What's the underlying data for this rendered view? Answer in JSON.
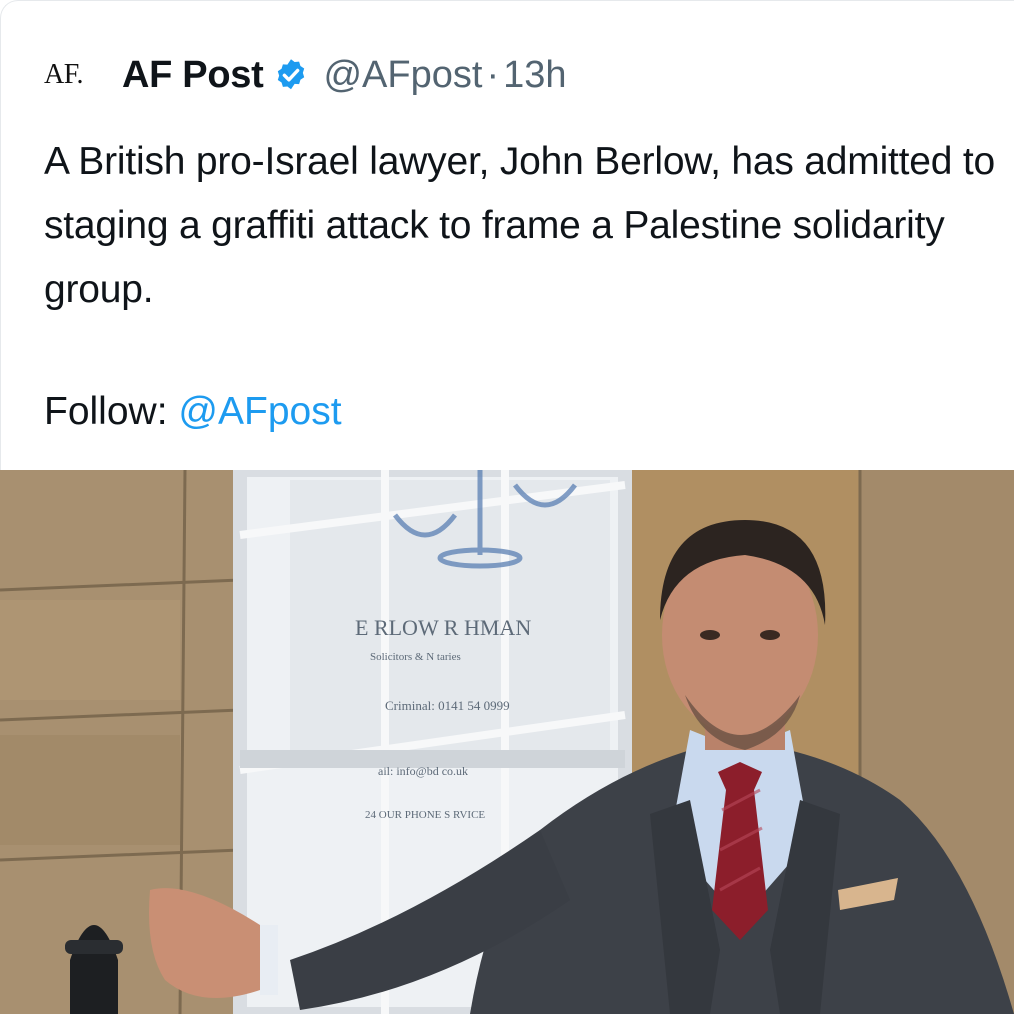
{
  "author": {
    "avatar_text": "AF.",
    "display_name": "AF Post",
    "verified_icon": "verified-badge-icon",
    "handle": "@AFpost",
    "separator": "·",
    "time": "13h"
  },
  "tweet": {
    "text": "A British pro-Israel lawyer, John Berlow, has admitted to staging a graffiti attack to frame a Palestine solidarity group.",
    "follow_label": "Follow:",
    "follow_handle": "@AFpost"
  },
  "photo": {
    "sign_name": "E RLOW R HMAN",
    "sign_sub": "Solicitors & N taries",
    "sign_phone": "Criminal: 0141 54 0999",
    "sign_email": "ail: info@bd co.uk",
    "sign_service": "24 OUR PHONE S RVICE"
  },
  "colors": {
    "link": "#1d9bf0",
    "verified": "#1d9bf0",
    "secondary_text": "#536471"
  }
}
